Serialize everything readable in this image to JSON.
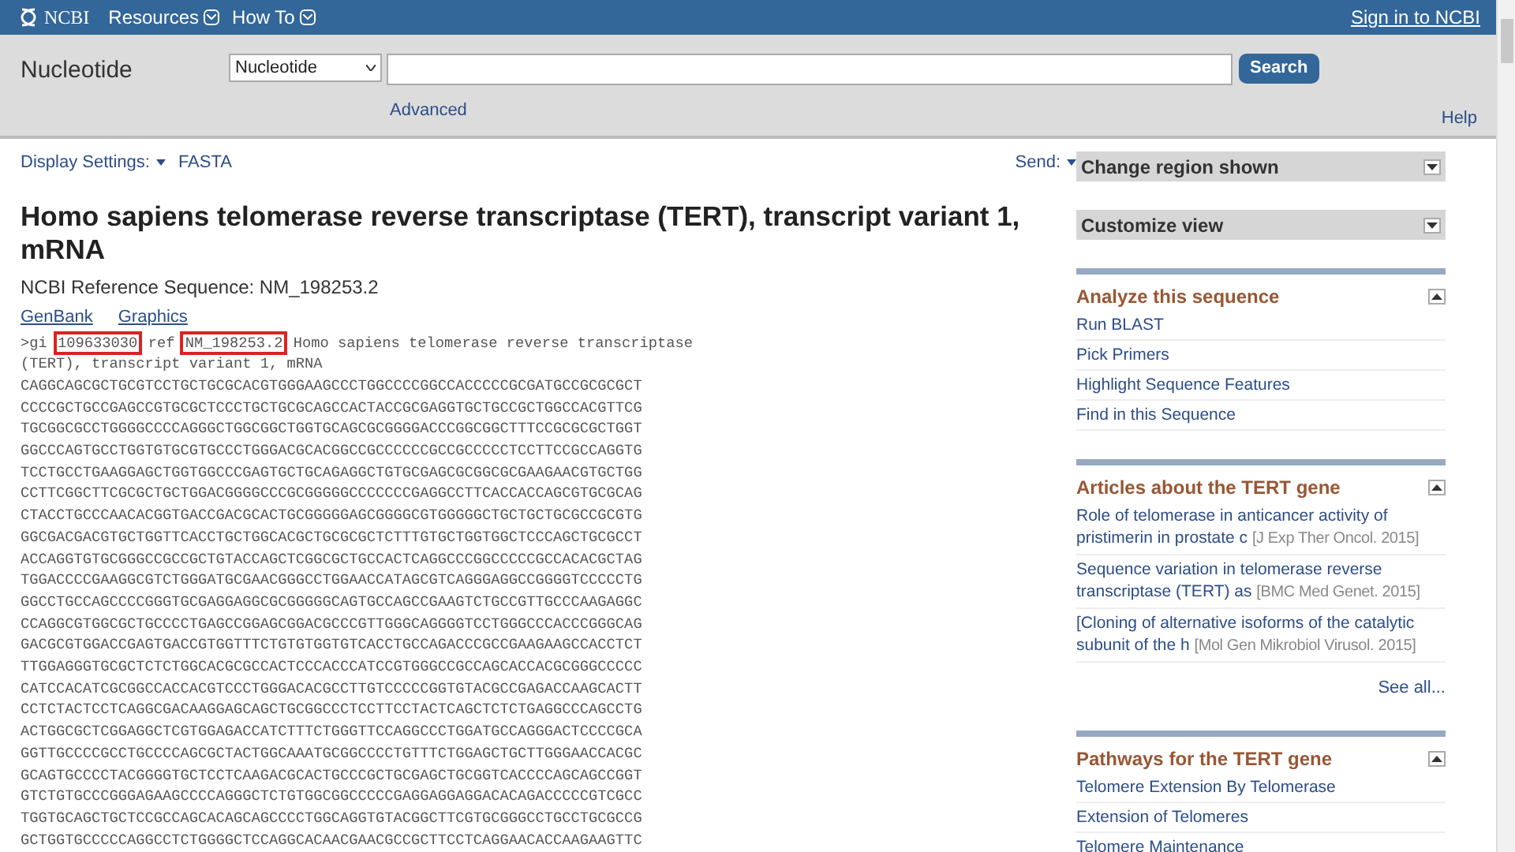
{
  "topbar": {
    "logo": "NCBI",
    "menus": [
      {
        "label": "Resources"
      },
      {
        "label": "How To"
      }
    ],
    "signin": "Sign in to NCBI"
  },
  "search": {
    "db_title": "Nucleotide",
    "db_select": "Nucleotide",
    "button": "Search",
    "advanced": "Advanced",
    "help": "Help"
  },
  "toolbar": {
    "display_settings": "Display Settings:",
    "format": "FASTA",
    "send": "Send:"
  },
  "record": {
    "title": "Homo sapiens telomerase reverse transcriptase (TERT), transcript variant 1, mRNA",
    "refseq": "NCBI Reference Sequence: NM_198253.2",
    "views": [
      {
        "label": "GenBank"
      },
      {
        "label": "Graphics"
      }
    ],
    "header": [
      {
        "text": ">gi",
        "highlighted": false
      },
      {
        "text": "109633030",
        "highlighted": true
      },
      {
        "text": "ref",
        "highlighted": false
      },
      {
        "text": "NM_198253.2",
        "highlighted": true
      },
      {
        "text": "Homo sapiens telomerase reverse transcriptase",
        "highlighted": false
      }
    ],
    "header_cont": "(TERT), transcript variant 1, mRNA",
    "sequence": [
      "CAGGCAGCGCTGCGTCCTGCTGCGCACGTGGGAAGCCCTGGCCCCGGCCACCCCCGCGATGCCGCGCGCT",
      "CCCCGCTGCCGAGCCGTGCGCTCCCTGCTGCGCAGCCACTACCGCGAGGTGCTGCCGCTGGCCACGTTCG",
      "TGCGGCGCCTGGGGCCCCAGGGCTGGCGGCTGGTGCAGCGCGGGGACCCGGCGGCTTTCCGCGCGCTGGT",
      "GGCCCAGTGCCTGGTGTGCGTGCCCTGGGACGCACGGCCGCCCCCCGCCGCCCCCTCCTTCCGCCAGGTG",
      "TCCTGCCTGAAGGAGCTGGTGGCCCGAGTGCTGCAGAGGCTGTGCGAGCGCGGCGCGAAGAACGTGCTGG",
      "CCTTCGGCTTCGCGCTGCTGGACGGGGCCCGCGGGGGCCCCCCCGAGGCCTTCACCACCAGCGTGCGCAG",
      "CTACCTGCCCAACACGGTGACCGACGCACTGCGGGGGAGCGGGGCGTGGGGGCTGCTGCTGCGCCGCGTG",
      "GGCGACGACGTGCTGGTTCACCTGCTGGCACGCTGCGCGCTCTTTGTGCTGGTGGCTCCCAGCTGCGCCT",
      "ACCAGGTGTGCGGGCCGCCGCTGTACCAGCTCGGCGCTGCCACTCAGGCCCGGCCCCCGCCACACGCTAG",
      "TGGACCCCGAAGGCGTCTGGGATGCGAACGGGCCTGGAACCATAGCGTCAGGGAGGCCGGGGTCCCCCTG",
      "GGCCTGCCAGCCCCGGGTGCGAGGAGGCGCGGGGGCAGTGCCAGCCGAAGTCTGCCGTTGCCCAAGAGGC",
      "CCAGGCGTGGCGCTGCCCCTGAGCCGGAGCGGACGCCCGTTGGGCAGGGGTCCTGGGCCCACCCGGGCAG",
      "GACGCGTGGACCGAGTGACCGTGGTTTCTGTGTGGTGTCACCTGCCAGACCCGCCGAAGAAGCCACCTCT",
      "TTGGAGGGTGCGCTCTCTGGCACGCGCCACTCCCACCCATCCGTGGGCCGCCAGCACCACGCGGGCCCCC",
      "CATCCACATCGCGGCCACCACGTCCCTGGGACACGCCTTGTCCCCCGGTGTACGCCGAGACCAAGCACTT",
      "CCTCTACTCCTCAGGCGACAAGGAGCAGCTGCGGCCCTCCTTCCTACTCAGCTCTCTGAGGCCCAGCCTG",
      "ACTGGCGCTCGGAGGCTCGTGGAGACCATCTTTCTGGGTTCCAGGCCCTGGATGCCAGGGACTCCCCGCA",
      "GGTTGCCCCGCCTGCCCCAGCGCTACTGGCAAATGCGGCCCCTGTTTCTGGAGCTGCTTGGGAACCACGC",
      "GCAGTGCCCCTACGGGGTGCTCCTCAAGACGCACTGCCCGCTGCGAGCTGCGGTCACCCCAGCAGCCGGT",
      "GTCTGTGCCCGGGAGAAGCCCCAGGGCTCTGTGGCGGCCCCCGAGGAGGAGGACACAGACCCCCGTCGCC",
      "TGGTGCAGCTGCTCCGCCAGCACAGCAGCCCCTGGCAGGTGTACGGCTTCGTGCGGGCCTGCCTGCGCCG",
      "GCTGGTGCCCCCAGGCCTCTGGGGCTCCAGGCACAACGAACGCCGCTTCCTCAGGAACACCAAGAAGTTC"
    ]
  },
  "sidebar": [
    {
      "title": "Change region shown",
      "expanded": false
    },
    {
      "title": "Customize view",
      "expanded": false
    },
    {
      "title": "Analyze this sequence",
      "expanded": true,
      "links": [
        {
          "text": "Run BLAST"
        },
        {
          "text": "Pick Primers"
        },
        {
          "text": "Highlight Sequence Features"
        },
        {
          "text": "Find in this Sequence"
        }
      ]
    },
    {
      "title": "Articles about the TERT gene",
      "expanded": true,
      "links": [
        {
          "text": "Role of telomerase in anticancer activity of pristimerin in prostate c",
          "source": "[J Exp Ther Oncol. 2015]"
        },
        {
          "text": "Sequence variation in telomerase reverse transcriptase (TERT) as",
          "source": "[BMC Med Genet. 2015]"
        },
        {
          "text": "[Cloning of alternative isoforms of the catalytic subunit of the h",
          "source": "[Mol Gen Mikrobiol Virusol. 2015]"
        }
      ],
      "more": "See all..."
    },
    {
      "title": "Pathways for the TERT gene",
      "expanded": true,
      "links": [
        {
          "text": "Telomere Extension By Telomerase"
        },
        {
          "text": "Extension of Telomeres"
        },
        {
          "text": "Telomere Maintenance"
        }
      ]
    }
  ]
}
